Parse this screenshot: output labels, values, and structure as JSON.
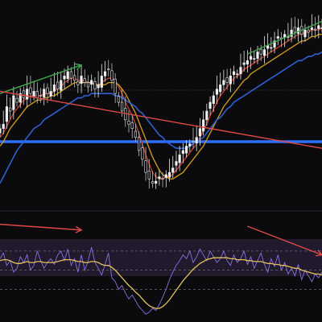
{
  "chart_data": [
    {
      "type": "candlestick",
      "panel": "price",
      "title": "",
      "xlabel": "",
      "ylabel": "",
      "ylim": [
        0,
        100
      ],
      "grid": false,
      "legend": "none",
      "x_count": 96,
      "note": "",
      "candles_close": [
        70,
        72,
        80,
        78,
        85,
        82,
        86,
        84,
        88,
        86,
        87,
        84,
        85,
        88,
        86,
        87,
        90,
        88,
        92,
        94,
        96,
        93,
        92,
        90,
        94,
        91,
        89,
        92,
        88,
        90,
        94,
        96,
        97,
        92,
        86,
        82,
        78,
        74,
        72,
        70,
        66,
        60,
        56,
        50,
        47,
        45,
        46,
        48,
        47,
        49,
        50,
        52,
        55,
        58,
        60,
        62,
        63,
        64,
        66,
        70,
        74,
        78,
        82,
        85,
        88,
        90,
        92,
        91,
        94,
        96,
        95,
        98,
        100,
        101,
        103,
        102,
        105,
        104,
        106,
        108,
        107,
        110,
        112,
        111,
        113,
        112,
        115,
        114,
        116,
        113,
        115,
        114,
        116,
        115,
        117,
        116
      ],
      "ma_series": [
        {
          "name": "",
          "color": "#c0392b",
          "values": [
            66,
            68,
            71,
            74,
            77,
            79,
            81,
            83,
            84,
            85,
            85,
            85,
            85,
            86,
            86,
            86,
            87,
            88,
            89,
            91,
            92,
            93,
            93,
            92,
            92,
            92,
            91,
            91,
            90,
            90,
            91,
            92,
            93,
            93,
            92,
            89,
            86,
            82,
            79,
            76,
            72,
            68,
            63,
            58,
            54,
            50,
            48,
            47,
            47,
            48,
            48,
            49,
            51,
            53,
            55,
            57,
            59,
            61,
            63,
            66,
            69,
            72,
            76,
            79,
            82,
            85,
            87,
            89,
            91,
            93,
            94,
            95,
            97,
            98,
            99,
            100,
            101,
            102,
            103,
            104,
            105,
            106,
            107,
            108,
            109,
            110,
            111,
            112,
            113,
            113,
            114,
            114,
            115,
            115,
            115,
            116
          ]
        },
        {
          "name": "",
          "color": "#c8961e",
          "values": [
            62,
            64,
            67,
            70,
            72,
            74,
            76,
            78,
            80,
            81,
            82,
            83,
            83,
            84,
            84,
            85,
            85,
            86,
            87,
            88,
            89,
            90,
            91,
            91,
            91,
            91,
            91,
            91,
            90,
            90,
            90,
            90,
            91,
            91,
            91,
            90,
            88,
            86,
            83,
            80,
            77,
            73,
            69,
            65,
            61,
            57,
            54,
            51,
            49,
            48,
            47,
            47,
            48,
            49,
            50,
            52,
            54,
            56,
            58,
            60,
            62,
            65,
            68,
            71,
            74,
            77,
            80,
            82,
            84,
            86,
            88,
            90,
            92,
            93,
            95,
            96,
            97,
            98,
            99,
            100,
            101,
            102,
            103,
            104,
            105,
            106,
            107,
            108,
            109,
            110,
            110,
            111,
            112,
            112,
            113,
            113
          ]
        },
        {
          "name": "",
          "color": "#2f5fd0",
          "values": [
            45,
            48,
            51,
            54,
            57,
            60,
            62,
            64,
            66,
            68,
            70,
            71,
            72,
            74,
            75,
            76,
            77,
            78,
            79,
            80,
            81,
            82,
            83,
            84,
            84,
            85,
            85,
            86,
            86,
            86,
            86,
            86,
            86,
            86,
            85,
            85,
            84,
            83,
            82,
            81,
            80,
            78,
            77,
            75,
            73,
            71,
            69,
            67,
            66,
            64,
            63,
            62,
            61,
            61,
            61,
            61,
            62,
            63,
            64,
            65,
            66,
            68,
            70,
            72,
            74,
            75,
            77,
            79,
            80,
            82,
            83,
            84,
            85,
            86,
            87,
            88,
            89,
            90,
            91,
            92,
            93,
            94,
            95,
            96,
            97,
            98,
            99,
            100,
            101,
            101,
            102,
            103,
            103,
            104,
            104,
            105
          ]
        }
      ],
      "annotations": [
        {
          "kind": "arrow",
          "color": "#3ea84a",
          "from": [
            0,
            86
          ],
          "to": [
            24,
            99
          ]
        },
        {
          "kind": "line",
          "color": "#3ea84a",
          "from": [
            73,
            104
          ],
          "to": [
            95,
            119
          ]
        },
        {
          "kind": "line",
          "color": "#e04848",
          "from": [
            0,
            87
          ],
          "to": [
            95,
            61
          ]
        },
        {
          "kind": "hline",
          "color": "#2f6fff",
          "y": 64
        }
      ]
    },
    {
      "type": "line",
      "panel": "oscillator",
      "title": "",
      "ylim": [
        0,
        100
      ],
      "grid": true,
      "reference_lines": [
        70,
        50,
        30
      ],
      "series": [
        {
          "name": "",
          "color": "#8a6fe0",
          "values": [
            62,
            68,
            55,
            60,
            48,
            52,
            64,
            58,
            66,
            50,
            55,
            70,
            60,
            52,
            58,
            62,
            56,
            66,
            70,
            60,
            72,
            55,
            62,
            48,
            66,
            50,
            60,
            74,
            58,
            52,
            45,
            56,
            68,
            42,
            38,
            30,
            34,
            26,
            20,
            24,
            18,
            12,
            8,
            4,
            6,
            10,
            8,
            14,
            22,
            30,
            40,
            48,
            55,
            60,
            66,
            62,
            70,
            58,
            64,
            72,
            66,
            60,
            70,
            64,
            58,
            62,
            70,
            60,
            55,
            66,
            58,
            62,
            70,
            56,
            64,
            52,
            60,
            68,
            56,
            48,
            62,
            54,
            66,
            50,
            58,
            46,
            52,
            44,
            56,
            40,
            50,
            44,
            38,
            46,
            42,
            48
          ]
        },
        {
          "name": "",
          "color": "#e2c15a",
          "values": [
            60,
            61,
            61,
            60,
            58,
            57,
            57,
            58,
            59,
            58,
            58,
            59,
            59,
            58,
            58,
            58,
            58,
            59,
            60,
            61,
            61,
            61,
            60,
            59,
            59,
            58,
            58,
            59,
            59,
            58,
            56,
            55,
            55,
            53,
            50,
            46,
            42,
            38,
            34,
            31,
            27,
            24,
            20,
            16,
            13,
            11,
            10,
            10,
            12,
            15,
            19,
            24,
            29,
            34,
            39,
            43,
            47,
            51,
            54,
            57,
            59,
            61,
            62,
            63,
            63,
            63,
            63,
            63,
            62,
            62,
            61,
            61,
            61,
            60,
            60,
            59,
            59,
            59,
            58,
            57,
            57,
            56,
            56,
            55,
            55,
            54,
            53,
            52,
            52,
            50,
            49,
            48,
            47,
            46,
            46,
            45
          ]
        }
      ],
      "annotations": [
        {
          "kind": "arrow",
          "color": "#e04848",
          "from": [
            0,
            98
          ],
          "to": [
            24,
            92
          ]
        },
        {
          "kind": "arrow",
          "color": "#e04848",
          "from": [
            73,
            96
          ],
          "to": [
            95,
            66
          ]
        }
      ]
    }
  ]
}
